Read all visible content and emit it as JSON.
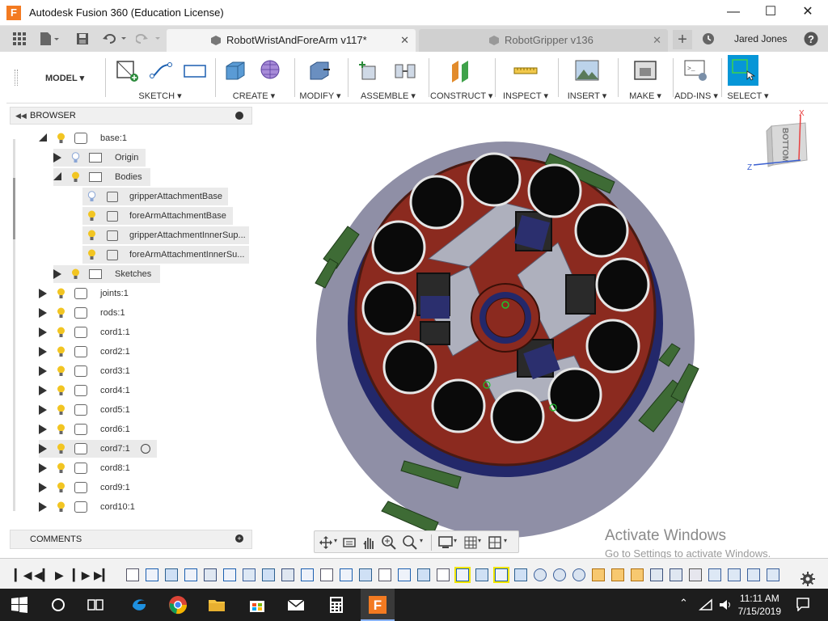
{
  "window": {
    "title": "Autodesk Fusion 360 (Education License)",
    "app_icon": "F"
  },
  "tabs": [
    {
      "label": "RobotWristAndForeArm v117*",
      "active": true
    },
    {
      "label": "RobotGripper v136",
      "active": false
    }
  ],
  "user": {
    "name": "Jared Jones"
  },
  "toolbar": {
    "workspace": "MODEL",
    "groups": [
      "SKETCH",
      "CREATE",
      "MODIFY",
      "ASSEMBLE",
      "CONSTRUCT",
      "INSPECT",
      "INSERT",
      "MAKE",
      "ADD-INS",
      "SELECT"
    ]
  },
  "browser": {
    "title": "BROWSER",
    "items": [
      {
        "label": "base:1"
      },
      {
        "label": "Origin"
      },
      {
        "label": "Bodies"
      },
      {
        "label": "gripperAttachmentBase"
      },
      {
        "label": "foreArmAttachmentBase"
      },
      {
        "label": "gripperAttachmentInnerSup..."
      },
      {
        "label": "foreArmAttachmentInnerSu..."
      },
      {
        "label": "Sketches"
      },
      {
        "label": "joints:1"
      },
      {
        "label": "rods:1"
      },
      {
        "label": "cord1:1"
      },
      {
        "label": "cord2:1"
      },
      {
        "label": "cord3:1"
      },
      {
        "label": "cord4:1"
      },
      {
        "label": "cord5:1"
      },
      {
        "label": "cord6:1"
      },
      {
        "label": "cord7:1"
      },
      {
        "label": "cord8:1"
      },
      {
        "label": "cord9:1"
      },
      {
        "label": "cord10:1"
      }
    ]
  },
  "comments": {
    "title": "COMMENTS"
  },
  "viewcube": {
    "face": "BOTTOM",
    "axis_x": "X",
    "axis_z": "Z"
  },
  "watermark": {
    "line1": "Activate Windows",
    "line2": "Go to Settings to activate Windows."
  },
  "taskbar": {
    "time": "11:11 AM",
    "date": "7/15/2019"
  },
  "colors": {
    "accent": "#0696d7",
    "model_red": "#8b2a1f",
    "model_gray": "#8f8fa6",
    "model_green": "#3e6b35",
    "model_navy": "#23286a"
  }
}
